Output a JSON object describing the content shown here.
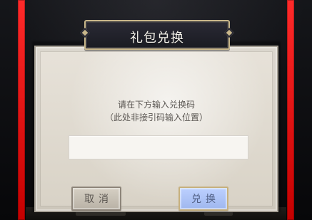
{
  "dialog": {
    "title": "礼包兑换",
    "instruction_line1": "请在下方输入兑换码",
    "instruction_line2": "（此处非接引码输入位置）",
    "input": {
      "value": "",
      "placeholder": ""
    },
    "buttons": {
      "cancel_label": "取消",
      "confirm_label": "兑换"
    }
  },
  "colors": {
    "frame_red": "#ff2a2a",
    "dialog_bg": "#e7e2d9",
    "title_bg": "#1a1b22",
    "title_border": "#c9b78a",
    "confirm_bg": "#a9c0f3",
    "cancel_bg": "#c6bfb3"
  }
}
